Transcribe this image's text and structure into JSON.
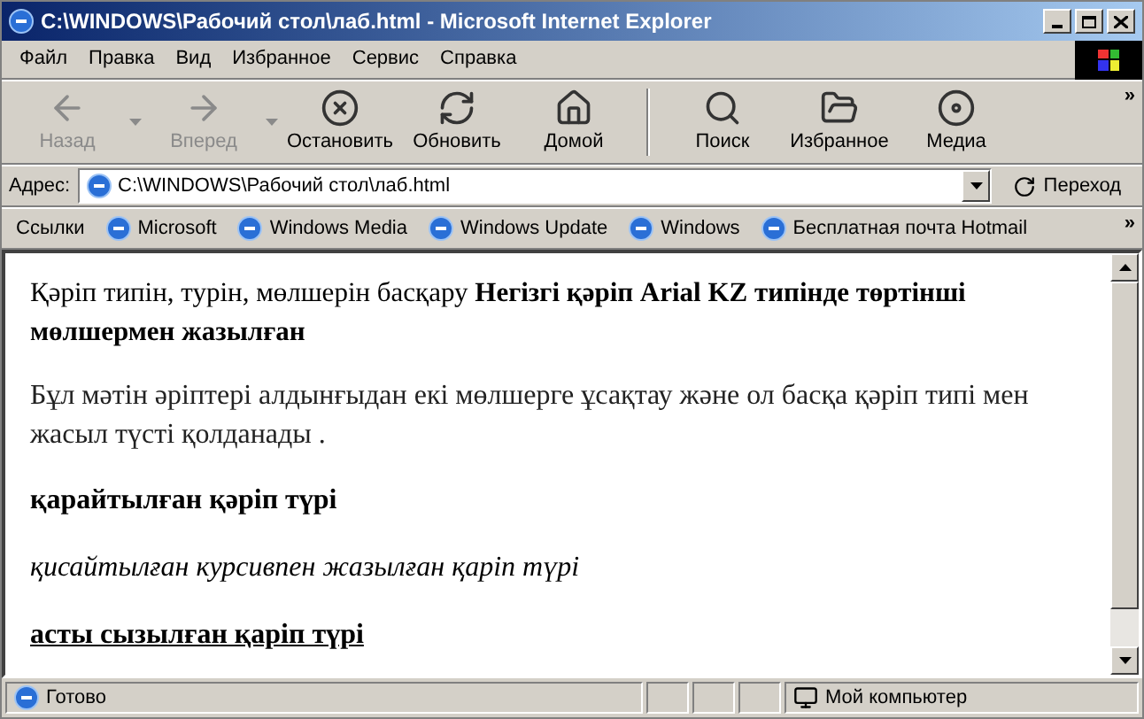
{
  "window": {
    "title": "C:\\WINDOWS\\Рабочий стол\\лаб.html - Microsoft Internet Explorer"
  },
  "menu": [
    "Файл",
    "Правка",
    "Вид",
    "Избранное",
    "Сервис",
    "Справка"
  ],
  "toolbar": [
    {
      "label": "Назад",
      "disabled": true,
      "dropdown": true
    },
    {
      "label": "Вперед",
      "disabled": true,
      "dropdown": true
    },
    {
      "label": "Остановить",
      "disabled": false,
      "dropdown": false
    },
    {
      "label": "Обновить",
      "disabled": false,
      "dropdown": false
    },
    {
      "label": "Домой",
      "disabled": false,
      "dropdown": false
    },
    {
      "label": "Поиск",
      "disabled": false,
      "dropdown": false
    },
    {
      "label": "Избранное",
      "disabled": false,
      "dropdown": false
    },
    {
      "label": "Медиа",
      "disabled": false,
      "dropdown": false
    }
  ],
  "toolbar_more": "»",
  "address": {
    "label": "Адрес:",
    "value": "C:\\WINDOWS\\Рабочий стол\\лаб.html",
    "go": "Переход"
  },
  "links": {
    "label": "Ссылки",
    "items": [
      "Microsoft",
      "Windows Media",
      "Windows Update",
      "Windows",
      "Бесплатная почта Hotmail"
    ],
    "more": "»"
  },
  "content": [
    {
      "kind": "mixed",
      "text": "Қәріп типін, турін, мөлшерін басқару **Негізгі қәріп Arial KZ типінде төртінші мөлшермен жазылған**"
    },
    {
      "kind": "small",
      "text": "Бұл мәтін әріптері алдынғыдан екі мөлшерге ұсақтау және ол басқа қәріп типі мен жасыл түсті қолданады ."
    },
    {
      "kind": "bold",
      "text": "қарайтылған қәріп түрі"
    },
    {
      "kind": "italic",
      "text": "қисайтылған курсивпен жазылған қаріп түрі"
    },
    {
      "kind": "underline",
      "text": "асты сызылған қаріп түрі"
    }
  ],
  "status_bar": {
    "text": "Готово",
    "zone": "Мой компьютер"
  }
}
